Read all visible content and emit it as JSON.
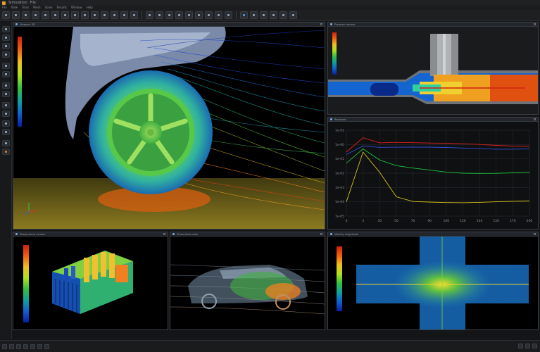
{
  "app": {
    "title": "Simulation",
    "subtitle": "File"
  },
  "menu": [
    "File",
    "View",
    "Tools",
    "Mesh",
    "Solve",
    "Results",
    "Window",
    "Help"
  ],
  "panels": {
    "main": {
      "title": "Viewport 3D"
    },
    "valve": {
      "title": "Pressure contour"
    },
    "residuals": {
      "title": "Residuals"
    },
    "heatsink": {
      "title": "Temperature contour"
    },
    "car": {
      "title": "Streamlines view"
    },
    "junction": {
      "title": "Velocity magnitude"
    }
  },
  "chart_data": {
    "type": "line",
    "title": "",
    "xlabel": "",
    "ylabel": "",
    "log_y": true,
    "grid": true,
    "x_ticks": [
      0,
      3,
      30,
      50,
      70,
      90,
      100,
      120,
      140,
      150,
      170,
      200
    ],
    "y_ticks": [
      "1e-02",
      "1e-00",
      "1e-01",
      "1e-02",
      "1e-03",
      "1e-04",
      "1e-05"
    ],
    "xlim": [
      0,
      200
    ],
    "series": [
      {
        "color": "#e02020",
        "values": [
          0.3,
          3,
          1.5,
          1.6,
          1.4,
          1.2,
          1.1,
          1.0,
          0.95,
          0.9,
          0.88,
          0.85
        ]
      },
      {
        "color": "#3050e0",
        "values": [
          0.2,
          0.8,
          0.7,
          0.65,
          0.6,
          0.58,
          0.56,
          0.55,
          0.55,
          0.54,
          0.54,
          0.53
        ]
      },
      {
        "color": "#20c040",
        "values": [
          0.05,
          0.5,
          0.08,
          0.03,
          0.02,
          0.015,
          0.012,
          0.011,
          0.011,
          0.011,
          0.011,
          0.011
        ]
      },
      {
        "color": "#d8c020",
        "values": [
          0.0001,
          0.3,
          0.01,
          0.0002,
          0.0001,
          0.0001,
          0.0001,
          0.0001,
          0.0001,
          0.0001,
          0.0001,
          0.0001
        ]
      }
    ]
  },
  "colors": {
    "accent": "#4a9cf0",
    "panel_border": "#3a3f46"
  }
}
